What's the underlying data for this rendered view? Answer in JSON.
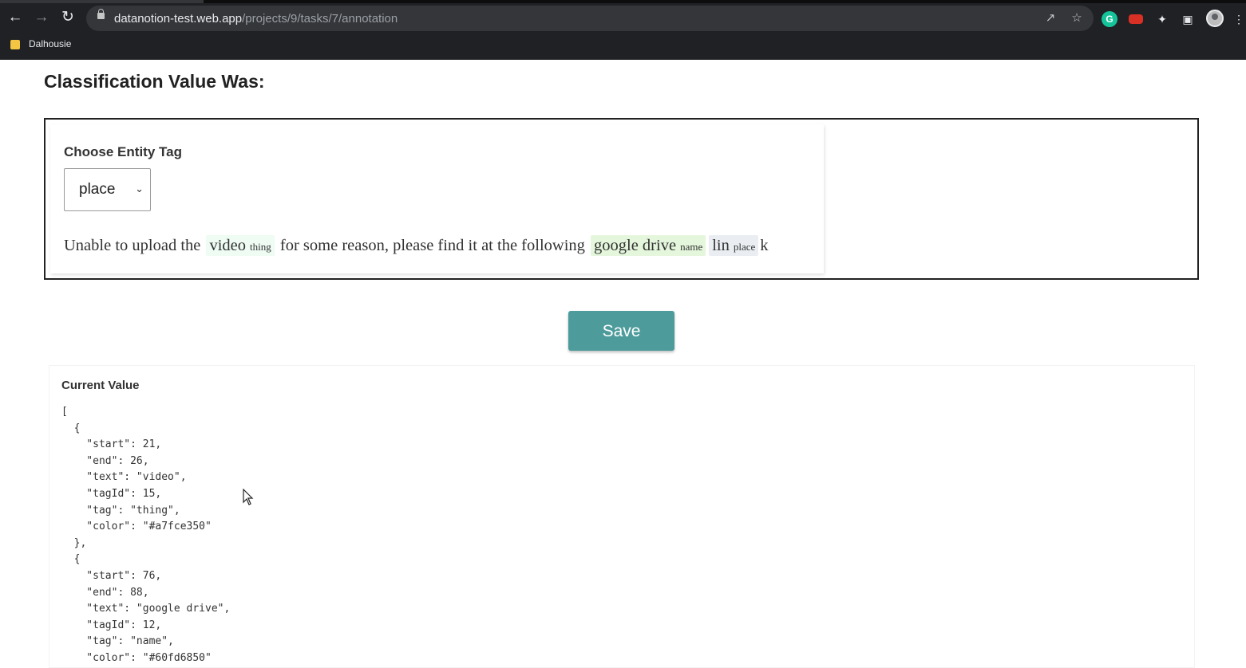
{
  "browser": {
    "url_host": "datanotion-test.web.app",
    "url_path": "/projects/9/tasks/7/annotation",
    "bookmark_label": "Dalhousie",
    "icons": [
      "back-icon",
      "forward-icon",
      "reload-icon",
      "lock-icon",
      "share-icon",
      "star-icon",
      "grammarly-icon",
      "extension-red-icon",
      "puzzle-icon",
      "sidepanel-icon",
      "avatar-icon",
      "more-icon"
    ]
  },
  "page": {
    "heading": "Classification Value Was:",
    "choose_label": "Choose Entity Tag",
    "select_value": "place",
    "sentence": {
      "part1": "Unable to upload the",
      "ent1_text": "video",
      "ent1_tag": "thing",
      "part2": "for some reason, please find it at the following",
      "ent2_text": "google drive",
      "ent2_tag": "name",
      "ent3_text": "lin",
      "ent3_tag": "place",
      "part3": "k"
    },
    "save_label": "Save",
    "current_value_label": "Current Value",
    "current_value_json": "[\n  {\n    \"start\": 21,\n    \"end\": 26,\n    \"text\": \"video\",\n    \"tagId\": 15,\n    \"tag\": \"thing\",\n    \"color\": \"#a7fce350\"\n  },\n  {\n    \"start\": 76,\n    \"end\": 88,\n    \"text\": \"google drive\",\n    \"tagId\": 12,\n    \"tag\": \"name\",\n    \"color\": \"#60fd6850\""
  },
  "colors": {
    "chrome_bg": "#202124",
    "omnibox_bg": "#35363a",
    "save_button": "#4e9b9b",
    "thing_highlight": "#eefcf3",
    "name_highlight": "#e4f6dc",
    "place_highlight": "#eaeef2"
  }
}
